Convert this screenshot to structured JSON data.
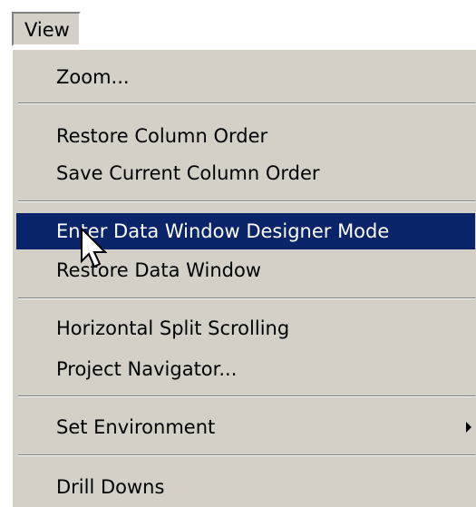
{
  "menubar": {
    "view_label": "View"
  },
  "menu": {
    "items": [
      {
        "label": "Zoom..."
      },
      {
        "label": "Restore Column Order"
      },
      {
        "label": "Save Current Column Order"
      },
      {
        "label": "Enter Data Window Designer Mode",
        "highlighted": true
      },
      {
        "label": "Restore Data Window"
      },
      {
        "label": "Horizontal Split Scrolling"
      },
      {
        "label": "Project Navigator..."
      },
      {
        "label": "Set Environment",
        "has_submenu": true
      },
      {
        "label": "Drill Downs"
      }
    ]
  },
  "colors": {
    "menu_background": "#d4d0c8",
    "highlight_background": "#0a246a",
    "highlight_text": "#ffffff",
    "text": "#000000"
  },
  "icons": {
    "submenu_arrow": "chevron-right-icon",
    "cursor": "mouse-pointer-icon"
  }
}
